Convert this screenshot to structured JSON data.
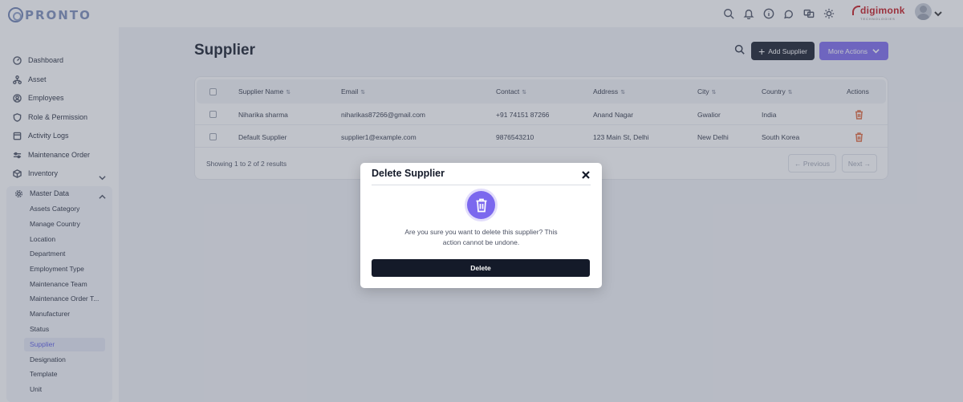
{
  "app": {
    "logo_text": "PRONTO",
    "brand_name": "digimonk",
    "brand_sub": "TECHNOLOGIES"
  },
  "topbar": {
    "icons": [
      "search-icon",
      "bell-icon",
      "info-icon",
      "chat-icon",
      "translate-icon",
      "sun-icon"
    ]
  },
  "sidebar": {
    "items": [
      {
        "label": "Dashboard",
        "icon": "dashboard-icon"
      },
      {
        "label": "Asset",
        "icon": "asset-icon"
      },
      {
        "label": "Employees",
        "icon": "employees-icon"
      },
      {
        "label": "Role & Permission",
        "icon": "shield-icon"
      },
      {
        "label": "Activity Logs",
        "icon": "log-icon"
      },
      {
        "label": "Maintenance Order",
        "icon": "sliders-icon"
      },
      {
        "label": "Inventory",
        "icon": "box-icon"
      },
      {
        "label": "Master Data",
        "icon": "gear-icon"
      }
    ],
    "master_data_items": [
      "Assets Category",
      "Manage Country",
      "Location",
      "Department",
      "Employment Type",
      "Maintenance Team",
      "Maintenance Order T...",
      "Manufacturer",
      "Status",
      "Supplier",
      "Designation",
      "Template",
      "Unit"
    ],
    "active_item": "Supplier"
  },
  "page": {
    "title": "Supplier",
    "add_button": "Add Supplier",
    "more_button": "More Actions"
  },
  "table": {
    "columns": [
      "Supplier Name",
      "Email",
      "Contact",
      "Address",
      "City",
      "Country",
      "Actions"
    ],
    "rows": [
      {
        "name": "Niharika sharma",
        "email": "niharikas87266@gmail.com",
        "contact": "+91 74151 87266",
        "address": "Anand Nagar",
        "city": "Gwalior",
        "country": "India"
      },
      {
        "name": "Default Supplier",
        "email": "supplier1@example.com",
        "contact": "9876543210",
        "address": "123 Main St, Delhi",
        "city": "New Delhi",
        "country": "South Korea"
      }
    ],
    "results_text": "Showing 1 to 2 of 2 results",
    "prev_label": "← Previous",
    "next_label": "Next →"
  },
  "modal": {
    "title": "Delete Supplier",
    "message_line1": "Are you sure you want to delete this supplier? This",
    "message_line2": "action cannot be undone.",
    "delete_label": "Delete"
  },
  "colors": {
    "accent": "#7b68ee",
    "primary_dark": "#141a29",
    "danger": "#e0663a"
  }
}
